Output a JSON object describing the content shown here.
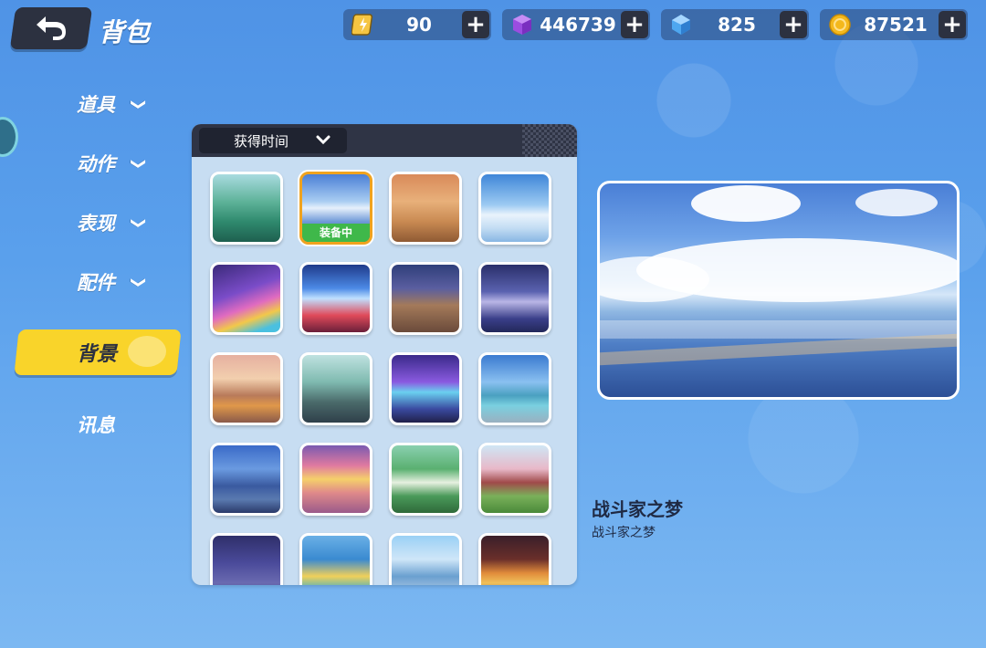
{
  "header": {
    "title": "背包",
    "resources": [
      {
        "name": "energy",
        "value": "90",
        "icon": "energy-card-icon",
        "color": "#f5c542"
      },
      {
        "name": "purple-gem",
        "value": "446739",
        "icon": "purple-cube-icon",
        "color": "#9b4de0"
      },
      {
        "name": "blue-diamond",
        "value": "825",
        "icon": "blue-diamond-icon",
        "color": "#4ea7f0"
      },
      {
        "name": "gold-coin",
        "value": "87521",
        "icon": "gold-coin-icon",
        "color": "#f4b81c"
      }
    ],
    "plus_label": "+"
  },
  "sidebar": {
    "items": [
      {
        "label": "道具",
        "chevron": "❯"
      },
      {
        "label": "动作",
        "chevron": "❯"
      },
      {
        "label": "表现",
        "chevron": "❯"
      },
      {
        "label": "配件",
        "chevron": "❯"
      }
    ],
    "active": {
      "label": "背景"
    },
    "plain": {
      "label": "讯息"
    }
  },
  "panel": {
    "sort_label": "获得时间",
    "equipped_label": "装备中",
    "tiles": [
      {
        "theme": "green-valley",
        "selected": false
      },
      {
        "theme": "cloud-lake",
        "selected": true
      },
      {
        "theme": "desert-town",
        "selected": false
      },
      {
        "theme": "snow-field",
        "selected": false
      },
      {
        "theme": "rainbow-road",
        "selected": false
      },
      {
        "theme": "neon-stage",
        "selected": false
      },
      {
        "theme": "night-street",
        "selected": false
      },
      {
        "theme": "night-lake",
        "selected": false
      },
      {
        "theme": "floating-islands",
        "selected": false
      },
      {
        "theme": "dusk-cliff",
        "selected": false
      },
      {
        "theme": "cyber-room",
        "selected": false
      },
      {
        "theme": "ice-castle",
        "selected": false
      },
      {
        "theme": "temple-ruins",
        "selected": false
      },
      {
        "theme": "sunset-sea",
        "selected": false
      },
      {
        "theme": "green-blocks",
        "selected": false
      },
      {
        "theme": "pagoda-garden",
        "selected": false
      },
      {
        "theme": "purple-ruins",
        "selected": false
      },
      {
        "theme": "water-park",
        "selected": false
      },
      {
        "theme": "city-sky",
        "selected": false
      },
      {
        "theme": "fire-arena",
        "selected": false
      }
    ]
  },
  "detail": {
    "name": "战斗家之梦",
    "description": "战斗家之梦"
  }
}
